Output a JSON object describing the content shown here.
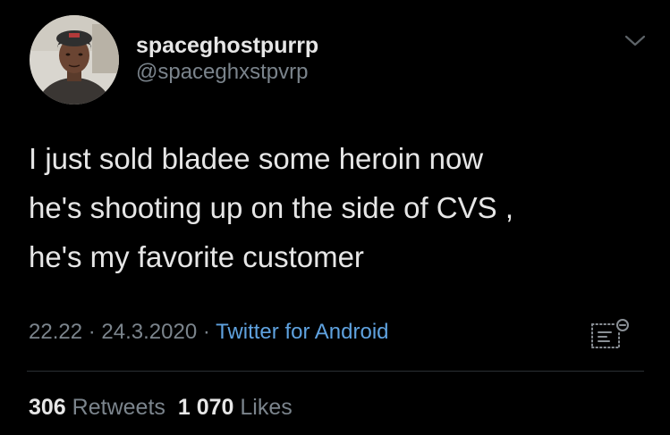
{
  "user": {
    "display_name": "spaceghostpurrp",
    "handle": "@spaceghxstpvrp",
    "avatar_icon": "user-avatar"
  },
  "tweet": {
    "text_lines": [
      "I just sold bladee some heroin now",
      "he's shooting up on the side of CVS ,",
      "he's my favorite customer"
    ],
    "time": "22.22",
    "date": "24.3.2020",
    "separator": "·",
    "source": "Twitter for Android"
  },
  "stats": {
    "retweets_count": "306",
    "retweets_label": "Retweets",
    "likes_count": "1 070",
    "likes_label": "Likes"
  },
  "icons": {
    "menu": "chevron-down-icon",
    "analytics": "analytics-icon"
  },
  "colors": {
    "background": "#000000",
    "text": "#e6e6e6",
    "secondary": "#7b848c",
    "link": "#5fa2df"
  }
}
